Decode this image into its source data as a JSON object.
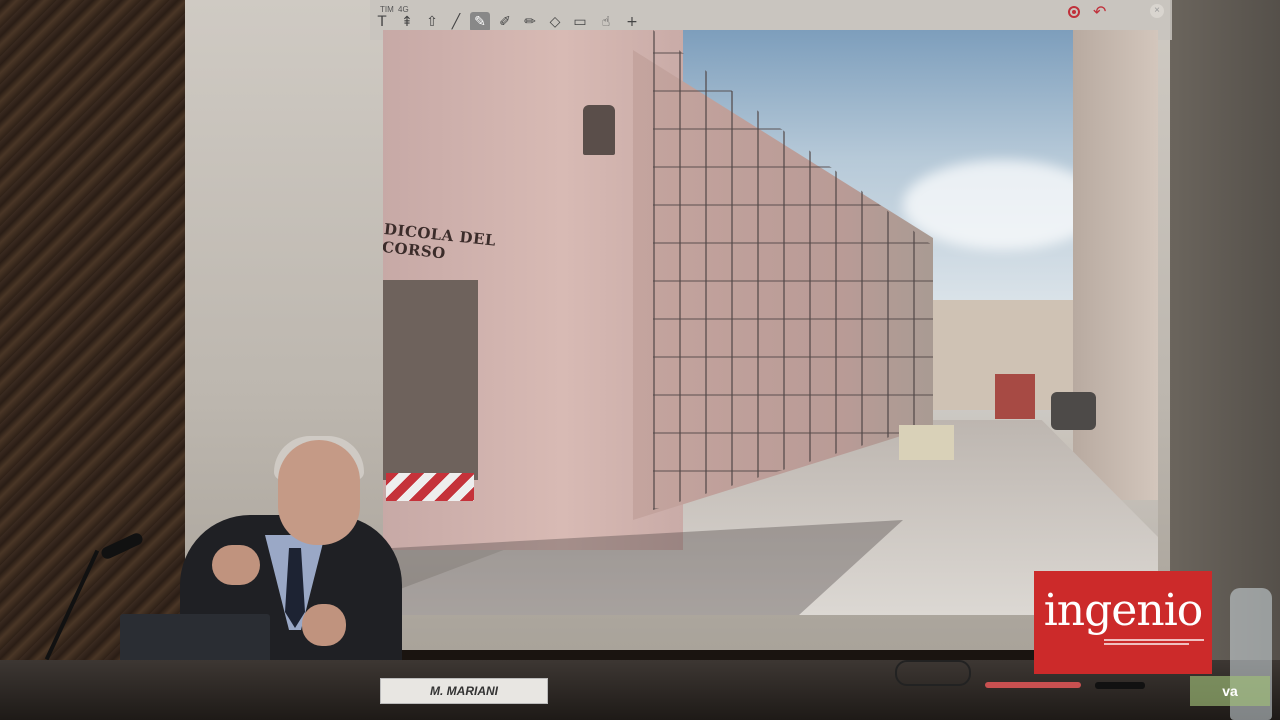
{
  "toolbar": {
    "carrier": "TIM",
    "network": "4G",
    "tools": [
      "text-tool",
      "strikethrough-tool",
      "upload-tool",
      "line-tool",
      "highlighter-tool",
      "pen-tool",
      "marker-tool",
      "eraser-tool",
      "rectangle-tool",
      "hand-tool",
      "plus-tool"
    ],
    "active_tool_index": 4
  },
  "slide": {
    "shop_sign": "DICOLA DEL CORSO"
  },
  "nameplate": "M. MARIANI",
  "logo": {
    "word": "ingenio"
  },
  "bottle_label": "va"
}
